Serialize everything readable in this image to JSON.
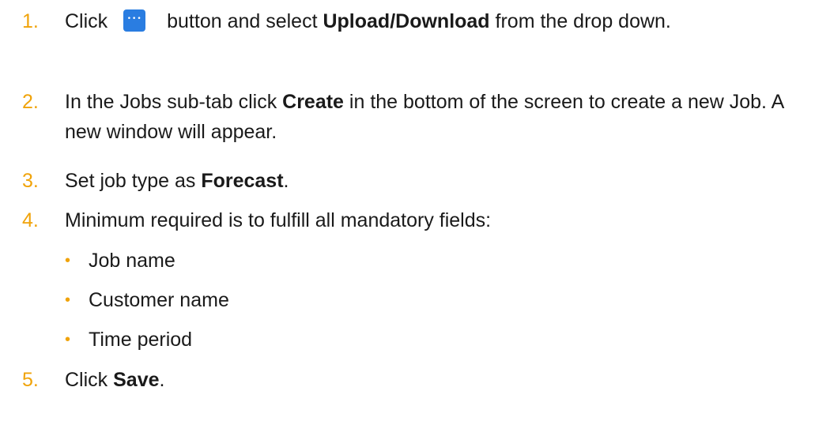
{
  "steps": [
    {
      "number": "1.",
      "pre": "Click",
      "button_icon": "more-options-icon",
      "mid": " button and select ",
      "bold": "Upload/Download",
      "post": " from the drop down."
    },
    {
      "number": "2.",
      "pre": "In the Jobs sub-tab click ",
      "bold": "Create",
      "post": " in the bottom of the screen to create a new Job. A new window will appear."
    },
    {
      "number": "3.",
      "pre": "Set job type as ",
      "bold": "Forecast",
      "post": "."
    },
    {
      "number": "4.",
      "text": "Minimum required is to fulfill all mandatory fields:"
    },
    {
      "number": "5.",
      "pre": "Click ",
      "bold": "Save",
      "post": "."
    }
  ],
  "mandatory_fields": [
    "Job name",
    "Customer name",
    "Time period"
  ],
  "colors": {
    "accent": "#f0a30a",
    "button": "#2a7de1"
  }
}
